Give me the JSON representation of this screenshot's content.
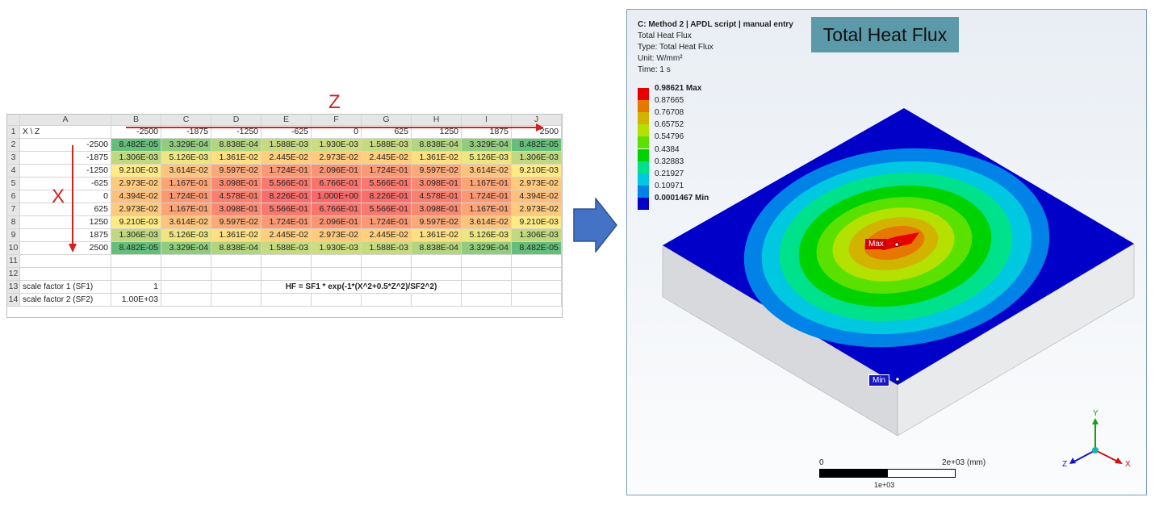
{
  "spreadsheet": {
    "col_headers": [
      "",
      "A",
      "B",
      "C",
      "D",
      "E",
      "F",
      "G",
      "H",
      "I",
      "J"
    ],
    "corner_label": "X \\ Z",
    "z_values": [
      "-2500",
      "-1875",
      "-1250",
      "-625",
      "0",
      "625",
      "1250",
      "1875",
      "2500"
    ],
    "row_numbers": [
      "1",
      "2",
      "3",
      "4",
      "5",
      "6",
      "7",
      "8",
      "9",
      "10",
      "11",
      "12",
      "13",
      "14"
    ],
    "data_rows": [
      {
        "x": "-2500",
        "cells": [
          "8.482E-05",
          "3.329E-04",
          "8.838E-04",
          "1.588E-03",
          "1.930E-03",
          "1.588E-03",
          "8.838E-04",
          "3.329E-04",
          "8.482E-05"
        ]
      },
      {
        "x": "-1875",
        "cells": [
          "1.306E-03",
          "5.126E-03",
          "1.361E-02",
          "2.445E-02",
          "2.973E-02",
          "2.445E-02",
          "1.361E-02",
          "5.126E-03",
          "1.306E-03"
        ]
      },
      {
        "x": "-1250",
        "cells": [
          "9.210E-03",
          "3.614E-02",
          "9.597E-02",
          "1.724E-01",
          "2.096E-01",
          "1.724E-01",
          "9.597E-02",
          "3.614E-02",
          "9.210E-03"
        ]
      },
      {
        "x": "-625",
        "cells": [
          "2.973E-02",
          "1.167E-01",
          "3.098E-01",
          "5.566E-01",
          "6.766E-01",
          "5.566E-01",
          "3.098E-01",
          "1.167E-01",
          "2.973E-02"
        ]
      },
      {
        "x": "0",
        "cells": [
          "4.394E-02",
          "1.724E-01",
          "4.578E-01",
          "8.226E-01",
          "1.000E+00",
          "8.226E-01",
          "4.578E-01",
          "1.724E-01",
          "4.394E-02"
        ]
      },
      {
        "x": "625",
        "cells": [
          "2.973E-02",
          "1.167E-01",
          "3.098E-01",
          "5.566E-01",
          "6.766E-01",
          "5.566E-01",
          "3.098E-01",
          "1.167E-01",
          "2.973E-02"
        ]
      },
      {
        "x": "1250",
        "cells": [
          "9.210E-03",
          "3.614E-02",
          "9.597E-02",
          "1.724E-01",
          "2.096E-01",
          "1.724E-01",
          "9.597E-02",
          "3.614E-02",
          "9.210E-03"
        ]
      },
      {
        "x": "1875",
        "cells": [
          "1.306E-03",
          "5.126E-03",
          "1.361E-02",
          "2.445E-02",
          "2.973E-02",
          "2.445E-02",
          "1.361E-02",
          "5.126E-03",
          "1.306E-03"
        ]
      },
      {
        "x": "2500",
        "cells": [
          "8.482E-05",
          "3.329E-04",
          "8.838E-04",
          "1.588E-03",
          "1.930E-03",
          "1.588E-03",
          "8.838E-04",
          "3.329E-04",
          "8.482E-05"
        ]
      }
    ],
    "sf1_label": "scale factor 1 (SF1)",
    "sf1_value": "1",
    "sf2_label": "scale factor 2 (SF2)",
    "sf2_value": "1.00E+03",
    "formula": "HF = SF1 * exp(-1*(X^2+0.5*Z^2)/SF2^2)",
    "z_axis_label": "Z",
    "x_axis_label": "X",
    "heat_colors": {
      "low": "#63be7b",
      "mid": "#ffeb84",
      "high": "#f8696b"
    }
  },
  "result": {
    "header_line": "C: Method 2 | APDL script | manual entry",
    "result_name": "Total Heat Flux",
    "type_line": "Type: Total Heat Flux",
    "unit_line": "Unit: W/mm²",
    "time_line": "Time: 1 s",
    "title_box": "Total Heat Flux",
    "legend": [
      {
        "label": "0.98621 Max",
        "color": "#e60000",
        "bold": true
      },
      {
        "label": "0.87665",
        "color": "#e67800",
        "bold": false
      },
      {
        "label": "0.76708",
        "color": "#d2b400",
        "bold": false
      },
      {
        "label": "0.65752",
        "color": "#b4e100",
        "bold": false
      },
      {
        "label": "0.54796",
        "color": "#5ae100",
        "bold": false
      },
      {
        "label": "0.4384",
        "color": "#00d200",
        "bold": false
      },
      {
        "label": "0.32883",
        "color": "#00e18c",
        "bold": false
      },
      {
        "label": "0.21927",
        "color": "#00c8e1",
        "bold": false
      },
      {
        "label": "0.10971",
        "color": "#0082e6",
        "bold": false
      },
      {
        "label": "0.0001467 Min",
        "color": "#0000c8",
        "bold": true
      }
    ],
    "max_marker": "Max",
    "min_marker": "Min",
    "scale_left": "0",
    "scale_right": "2e+03 (mm)",
    "scale_mid": "1e+03",
    "triad": {
      "y": "Y",
      "x": "X",
      "z": "Z"
    }
  },
  "arrow_color": "#4472c4"
}
